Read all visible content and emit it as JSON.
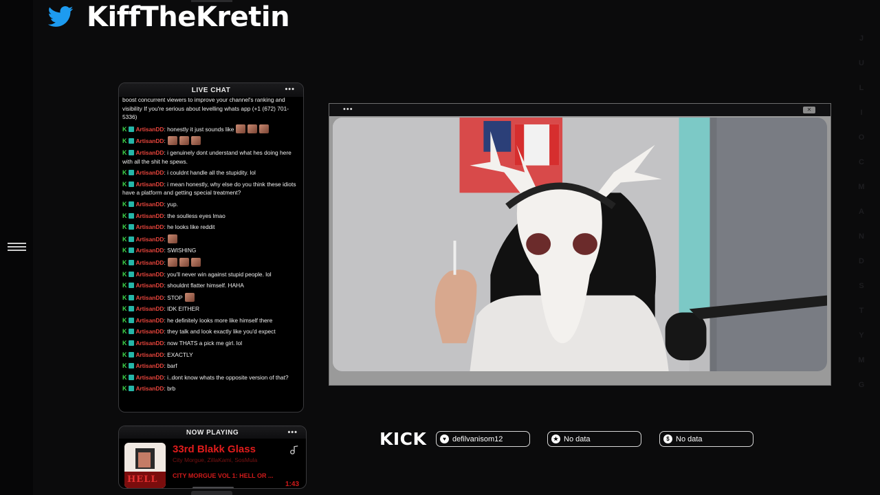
{
  "header": {
    "handle": "KiffTheKretin",
    "icon": "twitter-bird-icon"
  },
  "chat": {
    "title": "LIVE CHAT",
    "messages": [
      {
        "text": "boost concurrent viewers to improve your channel's ranking and visibility If you're serious about levelling whats app (+1 (672) 701-5336)",
        "cut": true
      },
      {
        "user": "ArtisanDD",
        "text": ": honestly it just sounds like",
        "emotes": 3
      },
      {
        "user": "ArtisanDD",
        "text": ":",
        "emotes": 3
      },
      {
        "user": "ArtisanDD",
        "text": ": i genuinely dont understand what hes doing here with all the shit he spews."
      },
      {
        "user": "ArtisanDD",
        "text": ": i couldnt handle all the stupidity. lol"
      },
      {
        "user": "ArtisanDD",
        "text": ": i mean honestly, why else do you think these idiots have a platform and getting special treatment?"
      },
      {
        "user": "ArtisanDD",
        "text": ": yup."
      },
      {
        "user": "ArtisanDD",
        "text": ": the soulless eyes lmao"
      },
      {
        "user": "ArtisanDD",
        "text": ": he looks like reddit"
      },
      {
        "user": "ArtisanDD",
        "text": ":",
        "emotes": 1
      },
      {
        "user": "ArtisanDD",
        "text": ": SWISHING"
      },
      {
        "user": "ArtisanDD",
        "text": ":",
        "emotes": 3
      },
      {
        "user": "ArtisanDD",
        "text": ": you'll never win against stupid people. lol"
      },
      {
        "user": "ArtisanDD",
        "text": ": shouldnt flatter himself. HAHA"
      },
      {
        "user": "ArtisanDD",
        "text": ": STOP",
        "emotes": 1
      },
      {
        "user": "ArtisanDD",
        "text": ": IDK EITHER"
      },
      {
        "user": "ArtisanDD",
        "text": ": he definitely looks more like himself there"
      },
      {
        "user": "ArtisanDD",
        "text": ": they talk and look exactly like you'd expect"
      },
      {
        "user": "ArtisanDD",
        "text": ": now THATS a pick me girl. lol"
      },
      {
        "user": "ArtisanDD",
        "text": ": EXACTLY"
      },
      {
        "user": "ArtisanDD",
        "text": ": barf"
      },
      {
        "user": "ArtisanDD",
        "text": ": i..dont know whats the opposite version of that?"
      },
      {
        "user": "ArtisanDD",
        "text": ": brb"
      }
    ]
  },
  "now_playing": {
    "title": "NOW PLAYING",
    "track": "33rd Blakk Glass",
    "artists": "City Morgue, ZillaKami, SosMula",
    "album": "CITY MORGUE VOL 1: HELL OR ...",
    "time": "1:43",
    "album_art_text": "HELL"
  },
  "kick": {
    "label": "KICK",
    "pills": [
      {
        "icon": "heart-icon",
        "text": "defilvanisom12"
      },
      {
        "icon": "star-icon",
        "text": "No data"
      },
      {
        "icon": "dollar-icon",
        "text": "No data"
      }
    ]
  },
  "right_letters": [
    "J",
    "U",
    "L",
    "I",
    "O",
    "C",
    "M",
    "A",
    "N",
    "D",
    "S",
    "T",
    "Y",
    "M",
    "G"
  ],
  "colors": {
    "username": "#e8453c",
    "kick_badge": "#3fd84b",
    "now_playing": "#e01c1c",
    "twitter": "#1d9bf0"
  }
}
